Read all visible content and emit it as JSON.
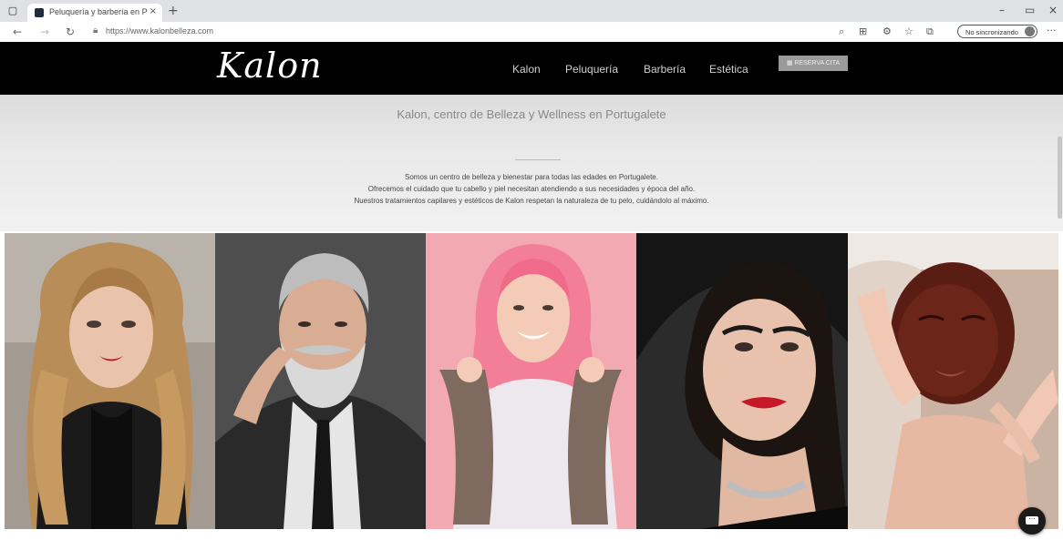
{
  "browser": {
    "tab_title": "Peluquería y barbería en Portug",
    "tab_close": "×",
    "new_tab": "+",
    "url": "https://www.kalonbelleza.com",
    "profile_label": "No sincronizando",
    "window_min": "–",
    "window_restore": "▭",
    "window_close": "×"
  },
  "site": {
    "logo": "Kalon",
    "menu": [
      "Kalon",
      "Peluquería",
      "Barbería",
      "Estética"
    ],
    "cta_label": "▦ RESERVA CITA"
  },
  "hero": {
    "title": "Kalon, centro de Belleza y Wellness en Portugalete",
    "lines": [
      "Somos un centro de belleza y bienestar para todas las edades en Portugalete.",
      "Ofrecemos el cuidado que tu cabello y piel necesitan atendiendo a sus necesidades y época del año.",
      "Nuestros tratamientos capilares y estéticos de Kalon respetan la naturaleza de tu pelo, cuidándolo al máximo."
    ]
  },
  "icons": {
    "tab_icon": "window-icon",
    "back": "back-arrow-icon",
    "forward": "forward-arrow-icon",
    "refresh": "refresh-icon",
    "lock": "lock-icon",
    "chat": "chat-bubble-icon"
  },
  "colors": {
    "header_bg": "#000000",
    "menu_text": "#cfcfcf",
    "cta_bg": "#9a9a9a",
    "hero_bg": "#e6e6e6"
  }
}
